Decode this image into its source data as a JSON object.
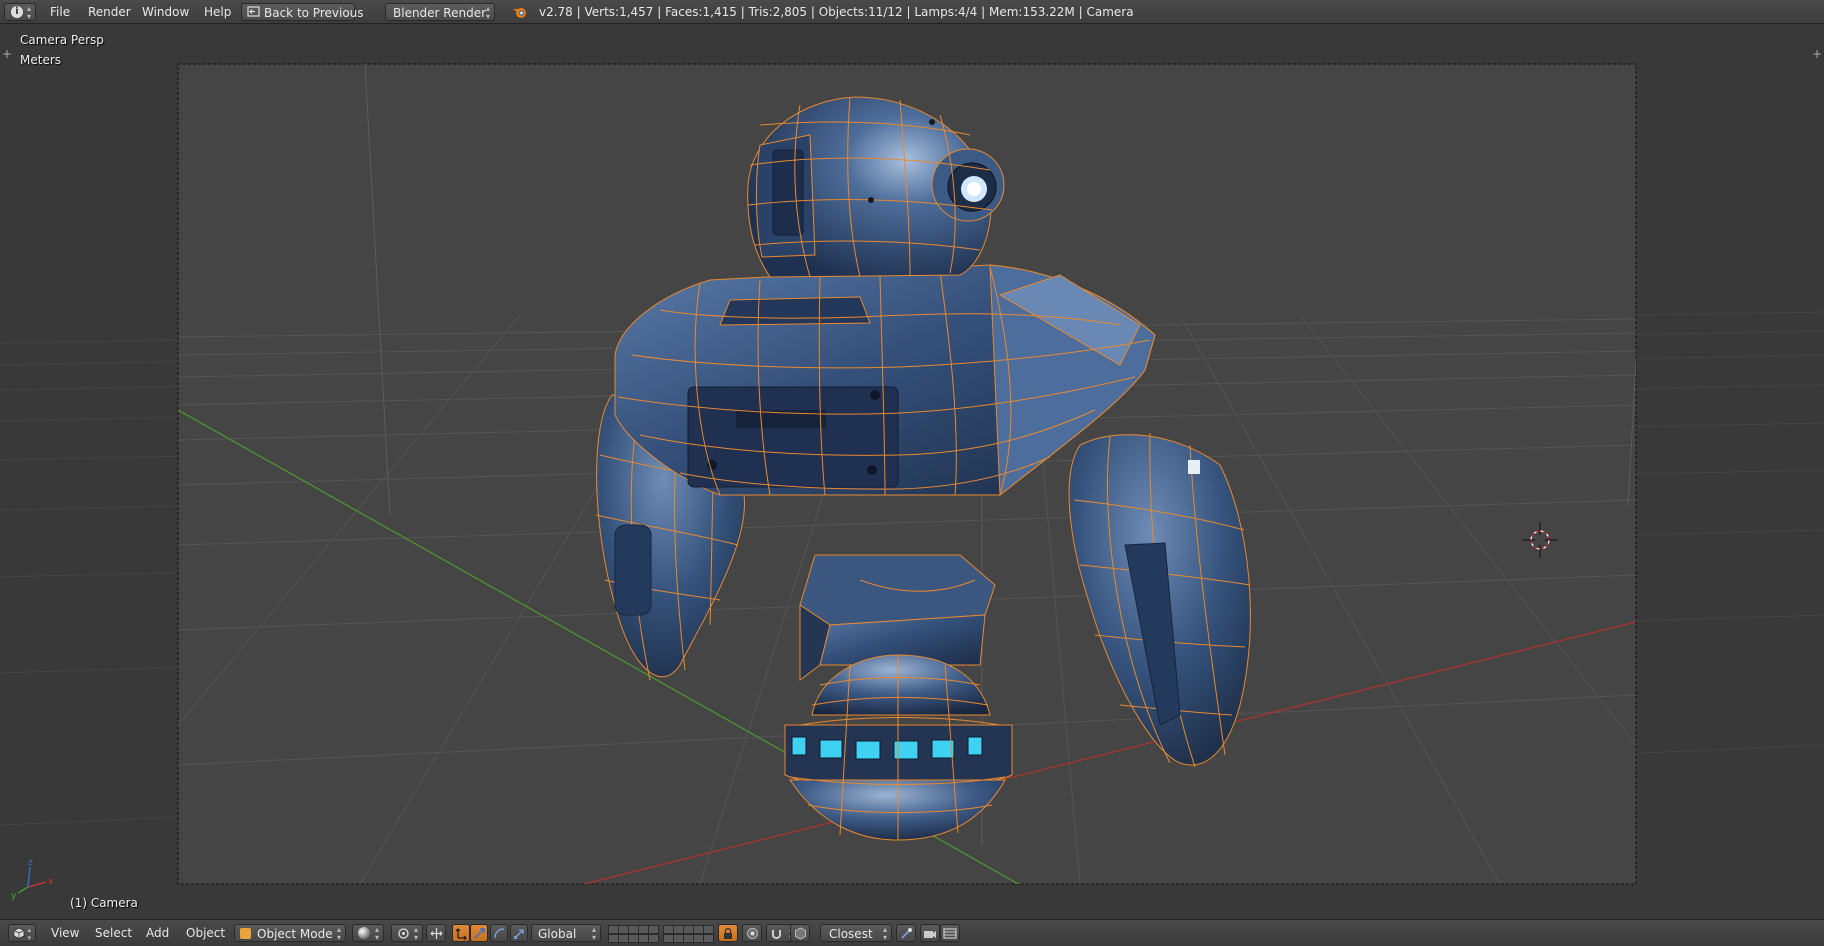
{
  "header": {
    "editor_type_icon": "info-icon",
    "menus": [
      "File",
      "Render",
      "Window",
      "Help"
    ],
    "back_button": "Back to Previous",
    "render_engine": "Blender Render",
    "blender_logo_icon": "blender-logo-icon",
    "stats": "v2.78 | Verts:1,457 | Faces:1,415 | Tris:2,805 | Objects:11/12 | Lamps:4/4 | Mem:153.22M | Camera"
  },
  "viewport": {
    "view_name": "Camera Persp",
    "units": "Meters",
    "object_info": "(1) Camera",
    "axis_labels": {
      "x": "x",
      "y": "y",
      "z": "z"
    },
    "colors": {
      "background": "#393939",
      "camera_frame": "#454545",
      "robot_body": "#324c70",
      "wire": "#e8892f",
      "lights": "#3ed1f2",
      "x_axis": "#b0322c",
      "y_axis": "#4c9a2a"
    }
  },
  "footer": {
    "editor_type_icon": "3d-view-icon",
    "menus": [
      "View",
      "Select",
      "Add",
      "Object"
    ],
    "mode": "Object Mode",
    "mode_icon": "object-mode-icon",
    "shading_icon": "viewport-shading-icon",
    "pivot_icon": "pivot-point-icon",
    "manipulator_icons": [
      "manipulator-toggle-icon",
      "translate-icon",
      "rotate-icon",
      "scale-icon"
    ],
    "orientation": "Global",
    "snap_target": "Closest",
    "icons": [
      "layers-icon",
      "lock-camera-icon",
      "proportional-edit-icon",
      "snap-icon",
      "snap-element-icon",
      "opengl-render-icon",
      "opengl-animation-icon"
    ]
  }
}
